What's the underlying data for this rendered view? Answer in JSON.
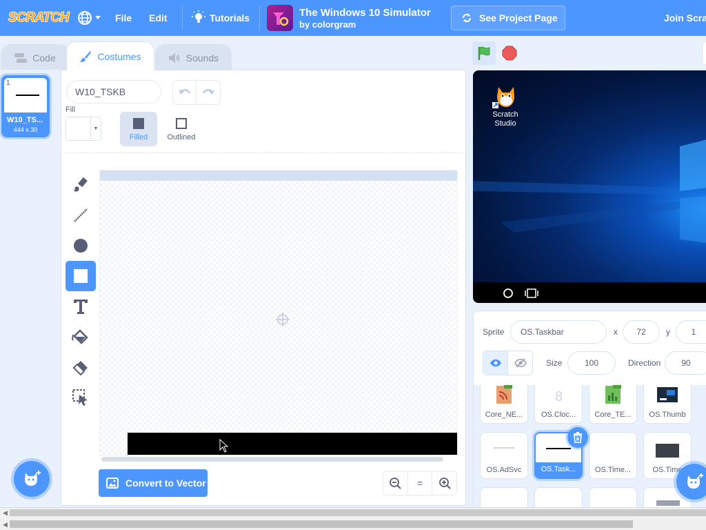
{
  "menubar": {
    "logo_text": "SCRATCH",
    "file": "File",
    "edit": "Edit",
    "tutorials": "Tutorials",
    "project_title": "The Windows 10 Simulator",
    "project_author": "by colorgram",
    "see_project": "See Project Page",
    "join": "Join Scra"
  },
  "tabs": {
    "code": "Code",
    "costumes": "Costumes",
    "sounds": "Sounds"
  },
  "costume_list": {
    "items": [
      {
        "number": "1",
        "name": "W10_TS...",
        "size": "444 x 30"
      }
    ]
  },
  "paint_editor": {
    "costume_name": "W10_TSKB",
    "fill_label": "Fill",
    "fill_color": "#ffffff",
    "filled_label": "Filled",
    "outlined_label": "Outlined",
    "tools": [
      "brush-icon",
      "line-icon",
      "circle-icon",
      "rectangle-icon",
      "text-icon",
      "fill-icon",
      "eraser-icon",
      "select-icon"
    ],
    "active_tool": "rectangle-icon",
    "convert_button": "Convert to Vector",
    "zoom_reset": "="
  },
  "stage": {
    "desktop_icon_label_1": "Scratch",
    "desktop_icon_label_2": "Studio"
  },
  "sprite_info": {
    "sprite_label": "Sprite",
    "sprite_name": "OS.Taskbar",
    "x_label": "x",
    "x_value": "72",
    "y_label": "y",
    "y_value": "1",
    "size_label": "Size",
    "size_value": "100",
    "direction_label": "Direction",
    "direction_value": "90"
  },
  "sprites": {
    "row1": [
      "Core_NE...",
      "OS.Cloc...",
      "Core_TE...",
      "OS.Thumb"
    ],
    "row2": [
      "OS.AdSvc",
      "OS.Task...",
      "OS.Time...",
      "OS.Time"
    ],
    "selected": "OS.Task..."
  },
  "colors": {
    "accent": "#4c97ff",
    "menubar": "#4c97ff",
    "flag": "#4cbf56",
    "stop": "#ec5959"
  }
}
